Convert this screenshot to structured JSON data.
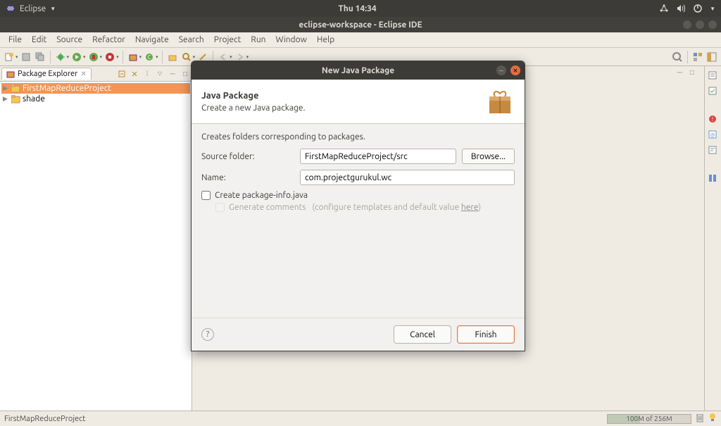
{
  "system": {
    "app_menu": "Eclipse",
    "time": "Thu 14:34"
  },
  "window": {
    "title": "eclipse-workspace - Eclipse IDE"
  },
  "menubar": [
    "File",
    "Edit",
    "Source",
    "Refactor",
    "Navigate",
    "Search",
    "Project",
    "Run",
    "Window",
    "Help"
  ],
  "explorer": {
    "tab_title": "Package Explorer",
    "items": [
      {
        "label": "FirstMapReduceProject",
        "selected": true
      },
      {
        "label": "shade",
        "selected": false
      }
    ]
  },
  "dialog": {
    "title": "New Java Package",
    "heading": "Java Package",
    "subheading": "Create a new Java package.",
    "intro": "Creates folders corresponding to packages.",
    "source_label": "Source folder:",
    "source_value": "FirstMapReduceProject/src",
    "browse": "Browse...",
    "name_label": "Name:",
    "name_value": "com.projectgurukul.wc",
    "pkginfo": "Create package-info.java",
    "gencomments": "Generate comments",
    "gencomments_hint_a": "(configure templates and default value ",
    "gencomments_link": "here",
    "gencomments_hint_b": ")",
    "cancel": "Cancel",
    "finish": "Finish"
  },
  "status": {
    "left": "FirstMapReduceProject",
    "mem": "100M of 256M"
  }
}
